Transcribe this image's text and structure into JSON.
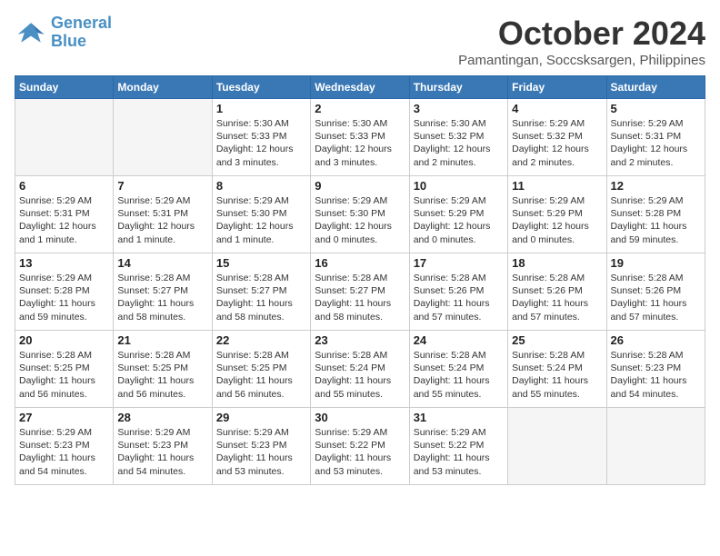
{
  "header": {
    "logo_line1": "General",
    "logo_line2": "Blue",
    "month": "October 2024",
    "location": "Pamantingan, Soccsksargen, Philippines"
  },
  "weekdays": [
    "Sunday",
    "Monday",
    "Tuesday",
    "Wednesday",
    "Thursday",
    "Friday",
    "Saturday"
  ],
  "weeks": [
    [
      {
        "day": "",
        "text": ""
      },
      {
        "day": "",
        "text": ""
      },
      {
        "day": "1",
        "text": "Sunrise: 5:30 AM\nSunset: 5:33 PM\nDaylight: 12 hours\nand 3 minutes."
      },
      {
        "day": "2",
        "text": "Sunrise: 5:30 AM\nSunset: 5:33 PM\nDaylight: 12 hours\nand 3 minutes."
      },
      {
        "day": "3",
        "text": "Sunrise: 5:30 AM\nSunset: 5:32 PM\nDaylight: 12 hours\nand 2 minutes."
      },
      {
        "day": "4",
        "text": "Sunrise: 5:29 AM\nSunset: 5:32 PM\nDaylight: 12 hours\nand 2 minutes."
      },
      {
        "day": "5",
        "text": "Sunrise: 5:29 AM\nSunset: 5:31 PM\nDaylight: 12 hours\nand 2 minutes."
      }
    ],
    [
      {
        "day": "6",
        "text": "Sunrise: 5:29 AM\nSunset: 5:31 PM\nDaylight: 12 hours\nand 1 minute."
      },
      {
        "day": "7",
        "text": "Sunrise: 5:29 AM\nSunset: 5:31 PM\nDaylight: 12 hours\nand 1 minute."
      },
      {
        "day": "8",
        "text": "Sunrise: 5:29 AM\nSunset: 5:30 PM\nDaylight: 12 hours\nand 1 minute."
      },
      {
        "day": "9",
        "text": "Sunrise: 5:29 AM\nSunset: 5:30 PM\nDaylight: 12 hours\nand 0 minutes."
      },
      {
        "day": "10",
        "text": "Sunrise: 5:29 AM\nSunset: 5:29 PM\nDaylight: 12 hours\nand 0 minutes."
      },
      {
        "day": "11",
        "text": "Sunrise: 5:29 AM\nSunset: 5:29 PM\nDaylight: 12 hours\nand 0 minutes."
      },
      {
        "day": "12",
        "text": "Sunrise: 5:29 AM\nSunset: 5:28 PM\nDaylight: 11 hours\nand 59 minutes."
      }
    ],
    [
      {
        "day": "13",
        "text": "Sunrise: 5:29 AM\nSunset: 5:28 PM\nDaylight: 11 hours\nand 59 minutes."
      },
      {
        "day": "14",
        "text": "Sunrise: 5:28 AM\nSunset: 5:27 PM\nDaylight: 11 hours\nand 58 minutes."
      },
      {
        "day": "15",
        "text": "Sunrise: 5:28 AM\nSunset: 5:27 PM\nDaylight: 11 hours\nand 58 minutes."
      },
      {
        "day": "16",
        "text": "Sunrise: 5:28 AM\nSunset: 5:27 PM\nDaylight: 11 hours\nand 58 minutes."
      },
      {
        "day": "17",
        "text": "Sunrise: 5:28 AM\nSunset: 5:26 PM\nDaylight: 11 hours\nand 57 minutes."
      },
      {
        "day": "18",
        "text": "Sunrise: 5:28 AM\nSunset: 5:26 PM\nDaylight: 11 hours\nand 57 minutes."
      },
      {
        "day": "19",
        "text": "Sunrise: 5:28 AM\nSunset: 5:26 PM\nDaylight: 11 hours\nand 57 minutes."
      }
    ],
    [
      {
        "day": "20",
        "text": "Sunrise: 5:28 AM\nSunset: 5:25 PM\nDaylight: 11 hours\nand 56 minutes."
      },
      {
        "day": "21",
        "text": "Sunrise: 5:28 AM\nSunset: 5:25 PM\nDaylight: 11 hours\nand 56 minutes."
      },
      {
        "day": "22",
        "text": "Sunrise: 5:28 AM\nSunset: 5:25 PM\nDaylight: 11 hours\nand 56 minutes."
      },
      {
        "day": "23",
        "text": "Sunrise: 5:28 AM\nSunset: 5:24 PM\nDaylight: 11 hours\nand 55 minutes."
      },
      {
        "day": "24",
        "text": "Sunrise: 5:28 AM\nSunset: 5:24 PM\nDaylight: 11 hours\nand 55 minutes."
      },
      {
        "day": "25",
        "text": "Sunrise: 5:28 AM\nSunset: 5:24 PM\nDaylight: 11 hours\nand 55 minutes."
      },
      {
        "day": "26",
        "text": "Sunrise: 5:28 AM\nSunset: 5:23 PM\nDaylight: 11 hours\nand 54 minutes."
      }
    ],
    [
      {
        "day": "27",
        "text": "Sunrise: 5:29 AM\nSunset: 5:23 PM\nDaylight: 11 hours\nand 54 minutes."
      },
      {
        "day": "28",
        "text": "Sunrise: 5:29 AM\nSunset: 5:23 PM\nDaylight: 11 hours\nand 54 minutes."
      },
      {
        "day": "29",
        "text": "Sunrise: 5:29 AM\nSunset: 5:23 PM\nDaylight: 11 hours\nand 53 minutes."
      },
      {
        "day": "30",
        "text": "Sunrise: 5:29 AM\nSunset: 5:22 PM\nDaylight: 11 hours\nand 53 minutes."
      },
      {
        "day": "31",
        "text": "Sunrise: 5:29 AM\nSunset: 5:22 PM\nDaylight: 11 hours\nand 53 minutes."
      },
      {
        "day": "",
        "text": ""
      },
      {
        "day": "",
        "text": ""
      }
    ]
  ]
}
